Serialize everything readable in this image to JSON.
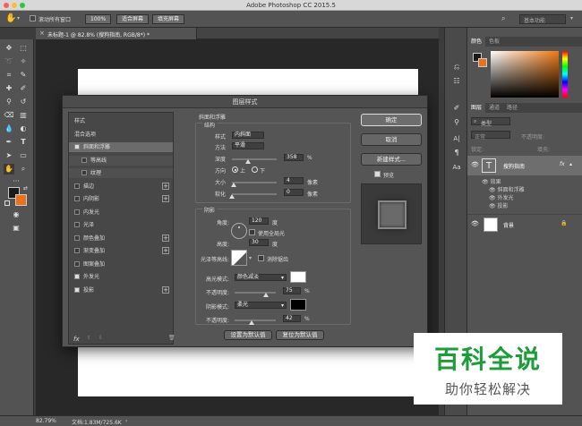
{
  "window": {
    "app_title": "Adobe Photoshop CC 2015.5"
  },
  "options_bar": {
    "scroll_all_label": "滚动所有窗口",
    "zoom_100_label": "100%",
    "fit_screen_label": "适合屏幕",
    "fill_screen_label": "填充屏幕",
    "workspace_label": "基本功能"
  },
  "document": {
    "tab_label": "未标题-1 @ 82.8% (搜狗指南, RGB/8*) *"
  },
  "status_bar": {
    "zoom": "82.79%",
    "doc_info": "文档:1.83M/725.6K"
  },
  "panels": {
    "color_tab": "颜色",
    "swatches_tab": "色板",
    "layers_tab": "图层",
    "channels_tab": "通道",
    "paths_tab": "路径",
    "kind_label": "类型",
    "blend_mode": "正常",
    "opacity_label": "不透明度:",
    "lock_label": "锁定:",
    "fill_label": "填充:",
    "text_layer_name": "搜狗指南",
    "effects_label": "效果",
    "effect_items": [
      "斜面和浮雕",
      "外发光",
      "投影"
    ],
    "bg_layer_name": "背景",
    "fx_label": "fx"
  },
  "dialog": {
    "title": "图层样式",
    "style_list": [
      {
        "label": "样式",
        "check": "none",
        "plus": false
      },
      {
        "label": "混合选项",
        "check": "none",
        "plus": false
      },
      {
        "label": "斜面和浮雕",
        "check": "on",
        "plus": false
      },
      {
        "label": "等高线",
        "check": "off",
        "plus": false
      },
      {
        "label": "纹理",
        "check": "off",
        "plus": false
      },
      {
        "label": "描边",
        "check": "off",
        "plus": true
      },
      {
        "label": "内阴影",
        "check": "off",
        "plus": true
      },
      {
        "label": "内发光",
        "check": "off",
        "plus": false
      },
      {
        "label": "光泽",
        "check": "off",
        "plus": false
      },
      {
        "label": "颜色叠加",
        "check": "off",
        "plus": true
      },
      {
        "label": "渐变叠加",
        "check": "off",
        "plus": true
      },
      {
        "label": "图案叠加",
        "check": "off",
        "plus": false
      },
      {
        "label": "外发光",
        "check": "on",
        "plus": false
      },
      {
        "label": "投影",
        "check": "on",
        "plus": true
      }
    ],
    "bevel": {
      "section_title": "斜面和浮雕",
      "structure_title": "结构",
      "style_label": "样式",
      "style_value": "内斜面",
      "technique_label": "方法",
      "technique_value": "平滑",
      "depth_label": "深度",
      "depth_value": "358",
      "depth_unit": "%",
      "depth_level": 0.36,
      "direction_label": "方向",
      "direction_up": "上",
      "direction_down": "下",
      "size_label": "大小",
      "size_value": "4",
      "size_unit": "像素",
      "size_level": 0.03,
      "soften_label": "软化",
      "soften_value": "0",
      "soften_unit": "像素",
      "soften_level": 0
    },
    "shading": {
      "title": "阴影",
      "angle_label": "角度:",
      "angle_value": "120",
      "angle_unit": "度",
      "global_light_label": "使用全局光",
      "altitude_label": "高度:",
      "altitude_value": "30",
      "altitude_unit": "度",
      "gloss_label": "光泽等高线:",
      "antialias_label": "消除锯齿",
      "highlight_mode_label": "高光模式:",
      "highlight_mode_value": "颜色减淡",
      "highlight_opacity_label": "不透明度:",
      "highlight_opacity_value": "75",
      "highlight_opacity_level": 0.75,
      "shadow_mode_label": "阴影模式:",
      "shadow_mode_value": "柔光",
      "shadow_opacity_label": "不透明度:",
      "shadow_opacity_value": "42",
      "shadow_opacity_level": 0.42,
      "pct": "%"
    },
    "buttons": {
      "ok": "确定",
      "cancel": "取消",
      "new_style": "新建样式...",
      "preview": "预览",
      "set_default": "设置为默认值",
      "reset_default": "复位为默认值"
    },
    "fx_label": "fx"
  },
  "watermark": {
    "line1": "百科全说",
    "line2": "助你轻松解决"
  },
  "colors": {
    "foreground": "#1a1a1a",
    "background": "#e8731a",
    "watermark_green": "#1d9c3a",
    "highlight_color": "#ffffff",
    "shadow_color": "#000000"
  }
}
